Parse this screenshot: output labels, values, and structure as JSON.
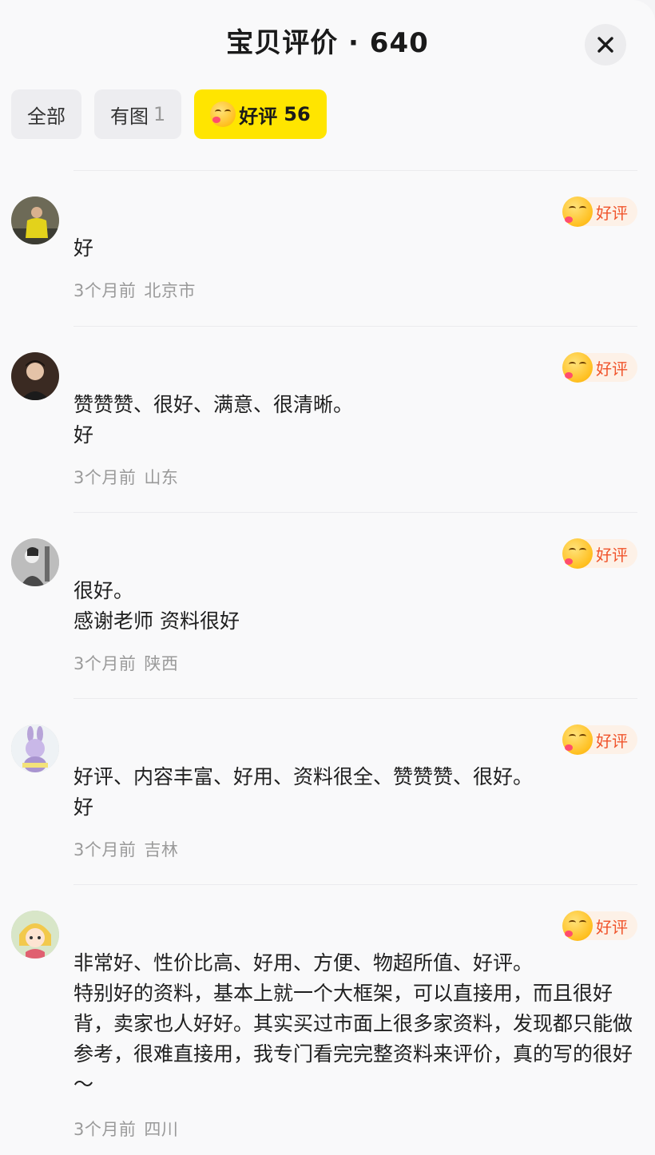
{
  "header": {
    "title": "宝贝评价 · 640"
  },
  "filters": [
    {
      "label": "全部",
      "count": ""
    },
    {
      "label": "有图",
      "count": "1"
    },
    {
      "label": "好评",
      "count": "56"
    }
  ],
  "badge_label": "好评",
  "colors": {
    "accent": "#ffe500",
    "badge_text": "#f0542b",
    "badge_bg": "#fdf1e7"
  },
  "reviews": [
    {
      "text": "好",
      "time": "3个月前",
      "location": "北京市"
    },
    {
      "text": "赞赞赞、很好、满意、很清晰。\n好",
      "time": "3个月前",
      "location": "山东"
    },
    {
      "text": "很好。\n感谢老师 资料很好",
      "time": "3个月前",
      "location": "陕西"
    },
    {
      "text": "好评、内容丰富、好用、资料很全、赞赞赞、很好。\n好",
      "time": "3个月前",
      "location": "吉林"
    },
    {
      "text": "非常好、性价比高、好用、方便、物超所值、好评。\n特别好的资料，基本上就一个大框架，可以直接用，而且很好背，卖家也人好好。其实买过市面上很多家资料，发现都只能做参考，很难直接用，我专门看完完整资料来评价，真的写的很好～",
      "time": "3个月前",
      "location": "四川"
    }
  ]
}
